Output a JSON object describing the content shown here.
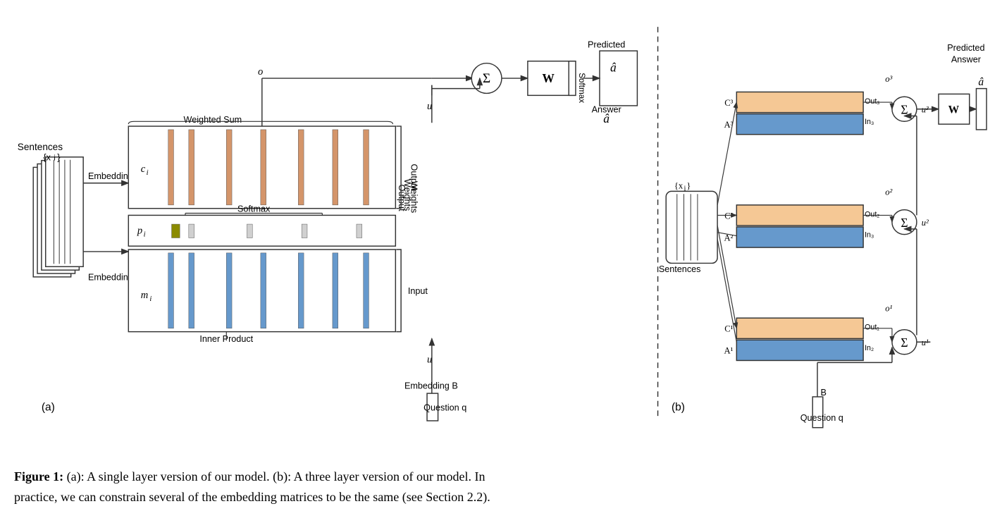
{
  "caption": {
    "figure_label": "Figure 1:",
    "part_a": "(a): A single layer version of our model.",
    "part_b": "(b): A three layer version of our model.",
    "rest": "In practice, we can constrain several of the embedding matrices to be the same (see Section 2.2).",
    "full": "Figure 1:  (a):  A single layer version of our model.  (b):  A three layer version of our model.  In practice, we can constrain several of the embedding matrices to be the same (see Section 2.2)."
  },
  "labels": {
    "sentences": "Sentences",
    "sentences_xi": "{x_i}",
    "embedding_c": "Embedding C",
    "embedding_a": "Embedding A",
    "embedding_b": "Embedding B",
    "ci": "c_i",
    "pi": "p_i",
    "mi": "m_i",
    "output_weights": "Output Weights",
    "input": "Input",
    "weighted_sum": "Weighted Sum",
    "softmax": "Softmax",
    "inner_product": "Inner Product",
    "u_bottom": "u",
    "u_top": "u",
    "o": "o",
    "w_box": "W",
    "predicted_answer_a": "Predicted Answer",
    "predicted_answer_hat": "â",
    "softmax_right": "Softmax",
    "question_q_a": "Question q",
    "part_a_label": "(a)",
    "part_b_label": "(b)",
    "sentences_b": "Sentences",
    "sentences_xi_b": "{x_i}",
    "question_q_b": "Question q",
    "b_label": "B",
    "predicted_answer_b": "Predicted Answer",
    "a_hat_b": "â",
    "w_box_b": "W",
    "c1": "C¹",
    "a1": "A¹",
    "c2": "C²",
    "a2": "A²",
    "c3": "C³",
    "a3": "A³",
    "u1": "u¹",
    "u2": "u²",
    "u3": "u³",
    "o1": "o¹",
    "o2": "o²",
    "o3": "o³",
    "out1": "Out₁",
    "in2": "In₂",
    "out2": "Out₂",
    "in3": "In₃",
    "out3": "Out₃"
  }
}
